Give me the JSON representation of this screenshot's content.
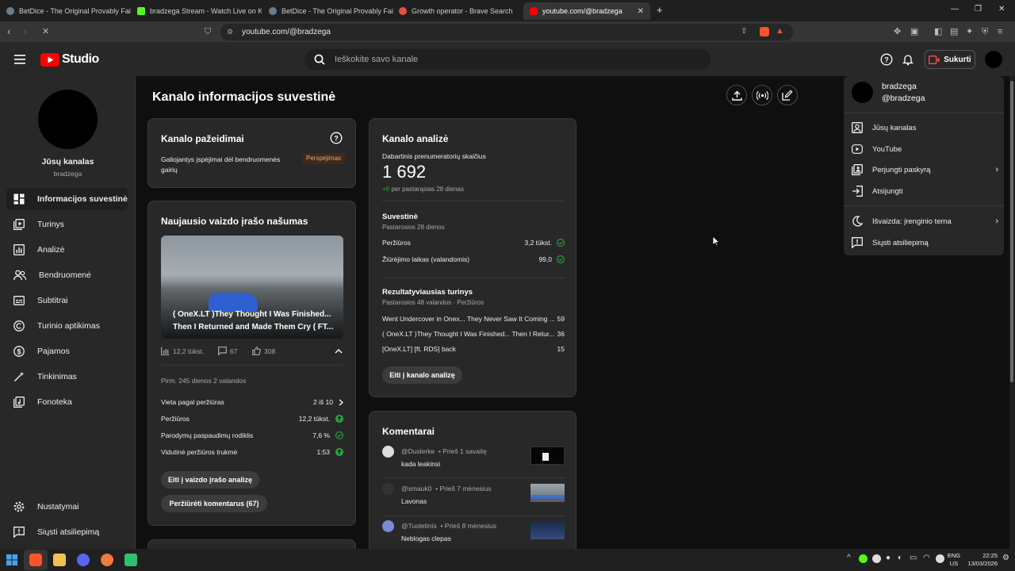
{
  "browser": {
    "tabs": [
      {
        "title": "BetDice - The Original Provably Fair C",
        "color": "#6b7b8c"
      },
      {
        "title": "bradzega Stream - Watch Live on Kic",
        "color": "#53fc18"
      },
      {
        "title": "BetDice - The Original Provably Fair C",
        "color": "#6b7b8c"
      },
      {
        "title": "Growth operator - Brave Search",
        "color": "#e2533a"
      },
      {
        "title": "youtube.com/@bradzega",
        "color": "#ff0000"
      }
    ],
    "url": "youtube.com/@bradzega"
  },
  "header": {
    "logo_text": "Studio",
    "search_placeholder": "Ieškokite savo kanale",
    "create_label": "Sukurti"
  },
  "sidebar": {
    "channel_label": "Jūsų kanalas",
    "channel_handle": "bradzega",
    "items": [
      {
        "label": "Informacijos suvestinė",
        "icon": "dashboard-icon"
      },
      {
        "label": "Turinys",
        "icon": "content-icon"
      },
      {
        "label": "Analizė",
        "icon": "analytics-icon"
      },
      {
        "label": "Bendruomenė",
        "icon": "community-icon"
      },
      {
        "label": "Subtitrai",
        "icon": "subtitles-icon"
      },
      {
        "label": "Turinio aptikimas",
        "icon": "copyright-icon"
      },
      {
        "label": "Pajamos",
        "icon": "dollar-icon"
      },
      {
        "label": "Tinkinimas",
        "icon": "magic-wand-icon"
      },
      {
        "label": "Fonoteka",
        "icon": "audio-library-icon"
      }
    ],
    "bottom": [
      {
        "label": "Nustatymai",
        "icon": "gear-icon"
      },
      {
        "label": "Siųsti atsiliepimą",
        "icon": "feedback-icon"
      }
    ]
  },
  "main": {
    "title": "Kanalo informacijos suvestinė",
    "violations": {
      "title": "Kanalo pažeidimai",
      "text": "Galiojantys įspėjimai dėl bendruomenės gairių",
      "badge": "Perspėjimas"
    },
    "latest": {
      "title": "Naujausio vaizdo įrašo našumas",
      "video_title": "( OneX.LT )They Thought I Was Finished... Then I Returned and Made Them Cry ( FT...",
      "views": "12,2 tūkst.",
      "comments": "67",
      "likes": "308",
      "first_since": "Pirm. 245 dienos 2 valandos",
      "stats": [
        {
          "label": "Vieta pagal peržiūras",
          "value": "2 iš 10",
          "mark": "chevron"
        },
        {
          "label": "Peržiūros",
          "value": "12,2 tūkst.",
          "mark": "up"
        },
        {
          "label": "Parodymų paspaudimų rodiklis",
          "value": "7,6 %",
          "mark": "check"
        },
        {
          "label": "Vidutinė peržiūros trukmė",
          "value": "1:53",
          "mark": "up"
        }
      ],
      "btn_analytics": "Eiti į vaizdo įrašo analizę",
      "btn_comments": "Peržiūrėti komentarus (67)"
    },
    "analytics": {
      "title": "Kanalo analizė",
      "subs_label": "Dabartinis prenumeratorių skaičius",
      "subs_value": "1 692",
      "subs_delta": "+6",
      "subs_delta_suffix": "per pastarąsias 28 dienas",
      "summary_title": "Suvestinė",
      "summary_period": "Pastarosios 28 dienos",
      "summary_rows": [
        {
          "label": "Peržiūros",
          "value": "3,2 tūkst."
        },
        {
          "label": "Žiūrėjimo laikas (valandomis)",
          "value": "99,0"
        }
      ],
      "top_title": "Rezultatyviausias turinys",
      "top_period": "Pastarosios 48 valandos · Peržiūros",
      "top_rows": [
        {
          "label": "Went Undercover in Onex... They Never Saw It Coming ...",
          "value": "59"
        },
        {
          "label": "( OneX.LT )They Thought I Was Finished... Then I Retur...",
          "value": "36"
        },
        {
          "label": "[OneX.LT] [ft. RDS] back",
          "value": "15"
        }
      ],
      "btn": "Eiti į kanalo analizę"
    },
    "comments": {
      "title": "Komentarai",
      "items": [
        {
          "author": "@Duslerke",
          "time": "• Prieš 1 savaitę",
          "text": "kada leakinsi"
        },
        {
          "author": "@smauk0",
          "time": "• Prieš 7 mėnesius",
          "text": "Lavonas"
        },
        {
          "author": "@Tuoletinis",
          "time": "• Prieš 8 mėnesius",
          "text": "Neblogas clepas"
        }
      ]
    }
  },
  "account_menu": {
    "name": "bradzega",
    "handle": "@bradzega",
    "items": [
      {
        "label": "Jūsų kanalas",
        "icon": "account-icon",
        "chevron": false
      },
      {
        "label": "YouTube",
        "icon": "youtube-icon",
        "chevron": false
      },
      {
        "label": "Perjungti paskyrą",
        "icon": "switch-account-icon",
        "chevron": true
      },
      {
        "label": "Atsijungti",
        "icon": "sign-out-icon",
        "chevron": false
      },
      {
        "label": "Išvaizda: įrenginio tema",
        "icon": "moon-icon",
        "chevron": true
      },
      {
        "label": "Siųsti atsiliepimą",
        "icon": "feedback-icon",
        "chevron": false
      }
    ]
  },
  "taskbar": {
    "lang": "ENG",
    "region": "US",
    "time": "22:25",
    "date": "13/03/2026"
  },
  "colors": {
    "accent_green": "#2ba640",
    "badge_bg": "#3d2a1c",
    "badge_fg": "#e6a77a",
    "yt_red": "#ff0000"
  }
}
